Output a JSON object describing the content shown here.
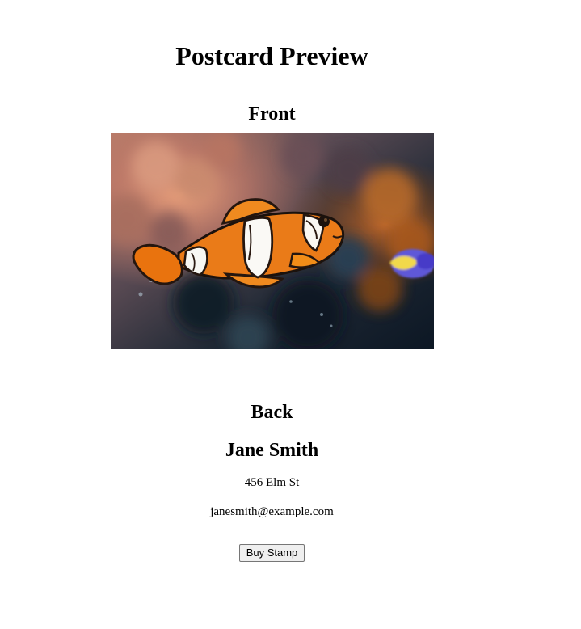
{
  "page": {
    "title": "Postcard Preview"
  },
  "front": {
    "title": "Front",
    "image_subject": "clownfish swimming near coral"
  },
  "back": {
    "title": "Back",
    "name": "Jane Smith",
    "address": "456 Elm St",
    "email": "janesmith@example.com"
  },
  "actions": {
    "buy_stamp_label": "Buy Stamp"
  }
}
